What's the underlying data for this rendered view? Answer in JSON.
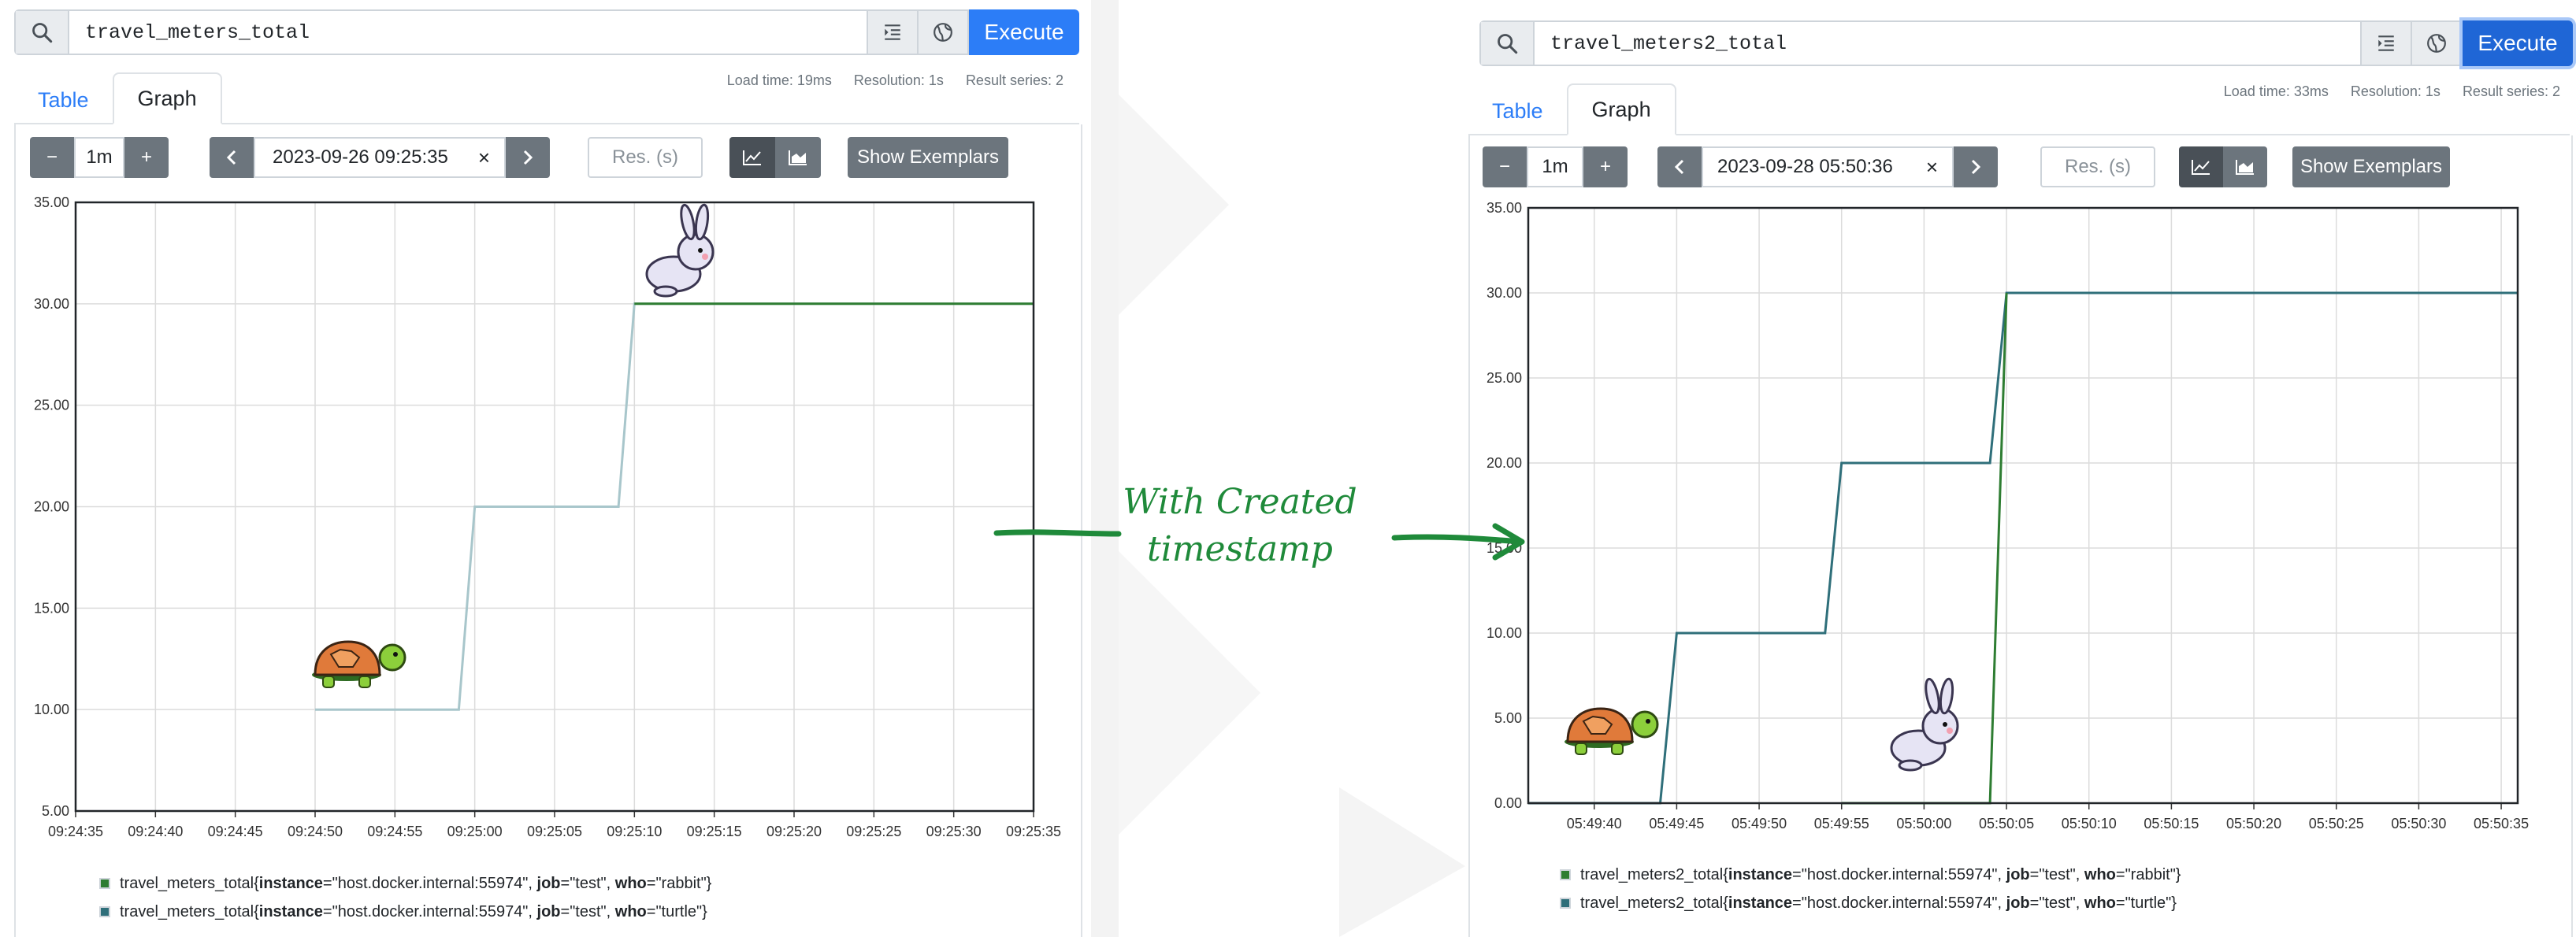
{
  "annotation": {
    "line1": "With Created",
    "line2": "timestamp",
    "color": "#1f8a3a"
  },
  "icons": {
    "search": "search-icon",
    "format": "format-indent-icon",
    "metrics": "metrics-explorer-globe-icon",
    "zoom_out": "minus-icon",
    "zoom_in": "plus-icon",
    "prev": "chevron-left-icon",
    "next": "chevron-right-icon",
    "clear": "close-icon",
    "line": "line-chart-icon",
    "stacked": "stacked-area-chart-icon",
    "turtle": "turtle-icon",
    "rabbit": "rabbit-icon"
  },
  "colors": {
    "execute": "#2c7df7",
    "series_green": "#2e7d32",
    "series_teal": "#2f6f7a",
    "series_light": "#a8c6cb"
  },
  "left": {
    "query": "travel_meters_total",
    "execute_label": "Execute",
    "stats": {
      "load_time": "Load time: 19ms",
      "resolution": "Resolution: 1s",
      "result_series": "Result series: 2"
    },
    "tabs": [
      "Table",
      "Graph"
    ],
    "active_tab": "Graph",
    "range": "1m",
    "end_time": "2023-09-26 09:25:35",
    "res_placeholder": "Res. (s)",
    "exemplars_label": "Show Exemplars",
    "legend": [
      {
        "metric": "travel_meters_total{",
        "k1": "instance",
        "v1": "=\"host.docker.internal:55974\", ",
        "k2": "job",
        "v2": "=\"test\", ",
        "k3": "who",
        "v3": "=\"rabbit\"}",
        "color": "#2e7d32"
      },
      {
        "metric": "travel_meters_total{",
        "k1": "instance",
        "v1": "=\"host.docker.internal:55974\", ",
        "k2": "job",
        "v2": "=\"test\", ",
        "k3": "who",
        "v3": "=\"turtle\"}",
        "color": "#2f6f7a"
      }
    ]
  },
  "right": {
    "query": "travel_meters2_total",
    "execute_label": "Execute",
    "stats": {
      "load_time": "Load time: 33ms",
      "resolution": "Resolution: 1s",
      "result_series": "Result series: 2"
    },
    "tabs": [
      "Table",
      "Graph"
    ],
    "active_tab": "Graph",
    "range": "1m",
    "end_time": "2023-09-28 05:50:36",
    "res_placeholder": "Res. (s)",
    "exemplars_label": "Show Exemplars",
    "legend": [
      {
        "metric": "travel_meters2_total{",
        "k1": "instance",
        "v1": "=\"host.docker.internal:55974\", ",
        "k2": "job",
        "v2": "=\"test\", ",
        "k3": "who",
        "v3": "=\"rabbit\"}",
        "color": "#2e7d32"
      },
      {
        "metric": "travel_meters2_total{",
        "k1": "instance",
        "v1": "=\"host.docker.internal:55974\", ",
        "k2": "job",
        "v2": "=\"test\", ",
        "k3": "who",
        "v3": "=\"turtle\"}",
        "color": "#2f6f7a"
      }
    ]
  },
  "chart_data": [
    {
      "type": "line",
      "ylim": [
        5,
        35
      ],
      "y_ticks": [
        "5.00",
        "10.00",
        "15.00",
        "20.00",
        "25.00",
        "30.00",
        "35.00"
      ],
      "x_start": "09:24:35",
      "x_end": "09:25:35",
      "x_ticks": [
        "09:24:35",
        "09:24:40",
        "09:24:45",
        "09:24:50",
        "09:24:55",
        "09:25:00",
        "09:25:05",
        "09:25:10",
        "09:25:15",
        "09:25:20",
        "09:25:25",
        "09:25:30",
        "09:25:35"
      ],
      "series": [
        {
          "color": "#a8c6cb",
          "points": [
            [
              "09:24:50",
              10
            ],
            [
              "09:24:59",
              10
            ],
            [
              "09:25:00",
              20
            ],
            [
              "09:25:09",
              20
            ],
            [
              "09:25:10",
              30
            ],
            [
              "09:25:35",
              30
            ]
          ]
        },
        {
          "color": "#2e7d32",
          "points": [
            [
              "09:25:10",
              30
            ],
            [
              "09:25:35",
              30
            ]
          ]
        }
      ]
    },
    {
      "type": "line",
      "ylim": [
        0,
        35
      ],
      "y_ticks": [
        "0.00",
        "5.00",
        "10.00",
        "15.00",
        "20.00",
        "25.00",
        "30.00",
        "35.00"
      ],
      "x_start": "05:49:36",
      "x_end": "05:50:36",
      "x_ticks": [
        "05:49:40",
        "05:49:45",
        "05:49:50",
        "05:49:55",
        "05:50:00",
        "05:50:05",
        "05:50:10",
        "05:50:15",
        "05:50:20",
        "05:50:25",
        "05:50:30",
        "05:50:35"
      ],
      "series": [
        {
          "color": "#2f6f7a",
          "points": [
            [
              "05:49:36",
              0
            ],
            [
              "05:49:44",
              0
            ],
            [
              "05:49:45",
              10
            ],
            [
              "05:49:54",
              10
            ],
            [
              "05:49:55",
              20
            ],
            [
              "05:50:04",
              20
            ],
            [
              "05:50:05",
              30
            ],
            [
              "05:50:36",
              30
            ]
          ]
        },
        {
          "color": "#2e7d32",
          "points": [
            [
              "05:49:55",
              0
            ],
            [
              "05:50:04",
              0
            ],
            [
              "05:50:05",
              30
            ]
          ]
        }
      ]
    }
  ]
}
